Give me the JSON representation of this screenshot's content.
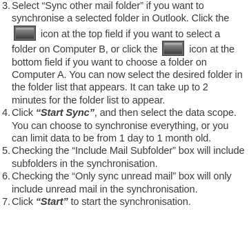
{
  "steps": [
    {
      "number": "3.",
      "parts": {
        "a": "Select “Sync other mail folder” if you want to synchronise a selected folder in Outlook. Click the",
        "b": "icon at the top field if you want to select a folder on Computer B, or click the",
        "c": "icon at the bottom field if you want to choose a folder on Computer A.  You can now select the desired folder in the folder list that appears. It can take up to 2 minutes for the folder list to appear."
      }
    },
    {
      "number": "4.",
      "parts": {
        "a": "Click ",
        "emph": "“Start Sync”",
        "b": ", and then select the data scope. You can choose to synchronise everything, or you can limit data to be from 1 day to 1 month old."
      }
    },
    {
      "number": "5.",
      "text": "Checking the “Include Mail Subfolder” box will include subfolders in the synchronisation."
    },
    {
      "number": "6.",
      "text": "Checking the “Only sync unread mail” box will only include unread mail in the synchronisation."
    },
    {
      "number": "7.",
      "parts": {
        "a": "Click ",
        "emph": "“Start”",
        "b": " to start the synchronisation."
      }
    }
  ],
  "icons": {
    "folder_icon": "folder-icon",
    "colors": {
      "frame": "#5a5a5a",
      "inner_top": "#8c8c8c",
      "inner_bottom": "#4a4a4a"
    }
  }
}
